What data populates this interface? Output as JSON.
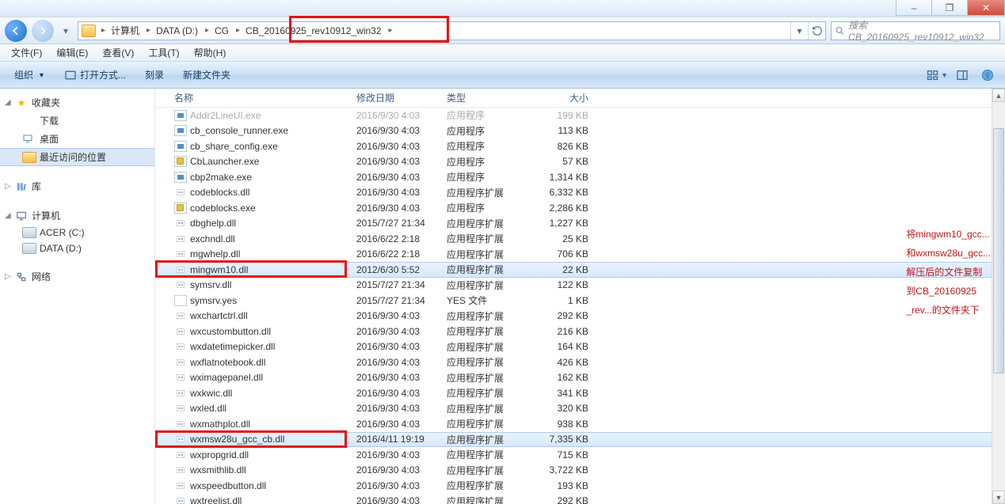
{
  "window_controls": {
    "min": "–",
    "max": "❐",
    "close": "✕"
  },
  "breadcrumbs": [
    "计算机",
    "DATA (D:)",
    "CG",
    "CB_20160925_rev10912_win32"
  ],
  "search_placeholder": "搜索 CB_20160925_rev10912_win32",
  "menu": {
    "file": "文件(F)",
    "edit": "编辑(E)",
    "view": "查看(V)",
    "tools": "工具(T)",
    "help": "帮助(H)"
  },
  "toolbar": {
    "organize": "组织",
    "open_with": "打开方式...",
    "burn": "刻录",
    "new_folder": "新建文件夹"
  },
  "sidebar": {
    "favorites": {
      "label": "收藏夹",
      "items": [
        {
          "label": "下载"
        },
        {
          "label": "桌面"
        },
        {
          "label": "最近访问的位置"
        }
      ]
    },
    "libraries": {
      "label": "库"
    },
    "computer": {
      "label": "计算机",
      "items": [
        {
          "label": "ACER (C:)"
        },
        {
          "label": "DATA (D:)"
        }
      ]
    },
    "network": {
      "label": "网络"
    }
  },
  "columns": {
    "name": "名称",
    "date": "修改日期",
    "type": "类型",
    "size": "大小"
  },
  "files": [
    {
      "icon": "exe",
      "name": "Addr2LineUI.exe",
      "date": "2016/9/30 4:03",
      "type": "应用程序",
      "size": "199 KB",
      "dim": true
    },
    {
      "icon": "exe",
      "name": "cb_console_runner.exe",
      "date": "2016/9/30 4:03",
      "type": "应用程序",
      "size": "113 KB"
    },
    {
      "icon": "exe",
      "name": "cb_share_config.exe",
      "date": "2016/9/30 4:03",
      "type": "应用程序",
      "size": "826 KB"
    },
    {
      "icon": "app",
      "name": "CbLauncher.exe",
      "date": "2016/9/30 4:03",
      "type": "应用程序",
      "size": "57 KB"
    },
    {
      "icon": "exe",
      "name": "cbp2make.exe",
      "date": "2016/9/30 4:03",
      "type": "应用程序",
      "size": "1,314 KB"
    },
    {
      "icon": "dll",
      "name": "codeblocks.dll",
      "date": "2016/9/30 4:03",
      "type": "应用程序扩展",
      "size": "6,332 KB"
    },
    {
      "icon": "app",
      "name": "codeblocks.exe",
      "date": "2016/9/30 4:03",
      "type": "应用程序",
      "size": "2,286 KB"
    },
    {
      "icon": "dll",
      "name": "dbghelp.dll",
      "date": "2015/7/27 21:34",
      "type": "应用程序扩展",
      "size": "1,227 KB"
    },
    {
      "icon": "dll",
      "name": "exchndl.dll",
      "date": "2016/6/22 2:18",
      "type": "应用程序扩展",
      "size": "25 KB"
    },
    {
      "icon": "dll",
      "name": "mgwhelp.dll",
      "date": "2016/6/22 2:18",
      "type": "应用程序扩展",
      "size": "706 KB"
    },
    {
      "icon": "dll",
      "name": "mingwm10.dll",
      "date": "2012/6/30 5:52",
      "type": "应用程序扩展",
      "size": "22 KB",
      "selected": true,
      "hl": true
    },
    {
      "icon": "dll",
      "name": "symsrv.dll",
      "date": "2015/7/27 21:34",
      "type": "应用程序扩展",
      "size": "122 KB"
    },
    {
      "icon": "yes",
      "name": "symsrv.yes",
      "date": "2015/7/27 21:34",
      "type": "YES 文件",
      "size": "1 KB"
    },
    {
      "icon": "dll",
      "name": "wxchartctrl.dll",
      "date": "2016/9/30 4:03",
      "type": "应用程序扩展",
      "size": "292 KB"
    },
    {
      "icon": "dll",
      "name": "wxcustombutton.dll",
      "date": "2016/9/30 4:03",
      "type": "应用程序扩展",
      "size": "216 KB"
    },
    {
      "icon": "dll",
      "name": "wxdatetimepicker.dll",
      "date": "2016/9/30 4:03",
      "type": "应用程序扩展",
      "size": "164 KB"
    },
    {
      "icon": "dll",
      "name": "wxflatnotebook.dll",
      "date": "2016/9/30 4:03",
      "type": "应用程序扩展",
      "size": "426 KB"
    },
    {
      "icon": "dll",
      "name": "wximagepanel.dll",
      "date": "2016/9/30 4:03",
      "type": "应用程序扩展",
      "size": "162 KB"
    },
    {
      "icon": "dll",
      "name": "wxkwic.dll",
      "date": "2016/9/30 4:03",
      "type": "应用程序扩展",
      "size": "341 KB"
    },
    {
      "icon": "dll",
      "name": "wxled.dll",
      "date": "2016/9/30 4:03",
      "type": "应用程序扩展",
      "size": "320 KB"
    },
    {
      "icon": "dll",
      "name": "wxmathplot.dll",
      "date": "2016/9/30 4:03",
      "type": "应用程序扩展",
      "size": "938 KB"
    },
    {
      "icon": "dll",
      "name": "wxmsw28u_gcc_cb.dll",
      "date": "2016/4/11 19:19",
      "type": "应用程序扩展",
      "size": "7,335 KB",
      "selected": true,
      "hl": true
    },
    {
      "icon": "dll",
      "name": "wxpropgrid.dll",
      "date": "2016/9/30 4:03",
      "type": "应用程序扩展",
      "size": "715 KB"
    },
    {
      "icon": "dll",
      "name": "wxsmithlib.dll",
      "date": "2016/9/30 4:03",
      "type": "应用程序扩展",
      "size": "3,722 KB"
    },
    {
      "icon": "dll",
      "name": "wxspeedbutton.dll",
      "date": "2016/9/30 4:03",
      "type": "应用程序扩展",
      "size": "193 KB"
    },
    {
      "icon": "dll",
      "name": "wxtreelist.dll",
      "date": "2016/9/30 4:03",
      "type": "应用程序扩展",
      "size": "292 KB"
    }
  ],
  "annotations": [
    "将mingwm10_gcc...",
    "和wxmsw28u_gcc...",
    "解压后的文件复制",
    "到CB_20160925",
    "_rev...的文件夹下"
  ]
}
